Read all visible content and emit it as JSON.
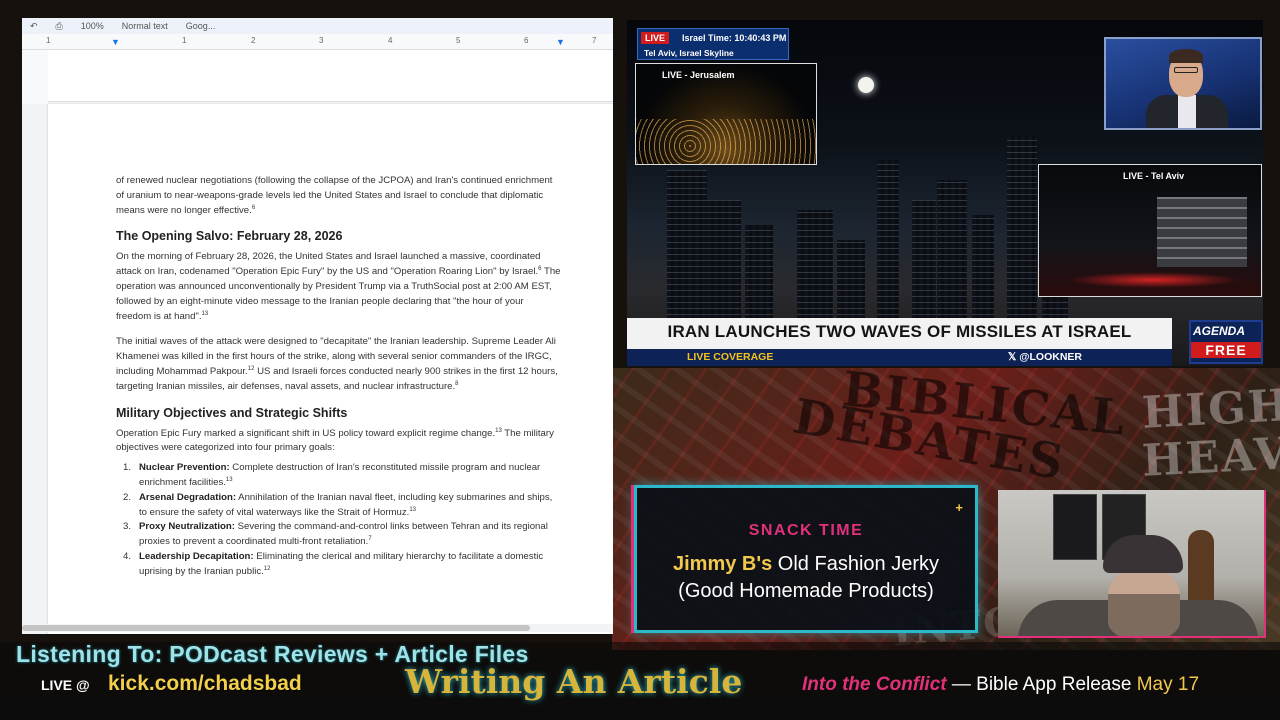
{
  "doc": {
    "toolbar": {
      "zoom": "100%",
      "style": "Normal text",
      "font": "Goog..."
    },
    "ruler": [
      "1",
      "1",
      "2",
      "3",
      "4",
      "5",
      "6",
      "7"
    ],
    "intro_paragraph": "of renewed nuclear negotiations (following the collapse of the JCPOA) and Iran's continued enrichment of uranium to near-weapons-grade levels led the United States and Israel to conclude that diplomatic means were no longer effective.",
    "intro_ref": "6",
    "heading1": "The Opening Salvo: February 28, 2026",
    "p1": "On the morning of February 28, 2026, the United States and Israel launched a massive, coordinated attack on Iran, codenamed \"Operation Epic Fury\" by the US and \"Operation Roaring Lion\" by Israel.",
    "p1_ref1": "6",
    "p1_b": " The operation was announced unconventionally by President Trump via a TruthSocial post at 2:00 AM EST, followed by an eight-minute video message to the Iranian people declaring that \"the hour of your freedom is at hand\".",
    "p1_ref2": "13",
    "p2": "The initial waves of the attack were designed to \"decapitate\" the Iranian leadership. Supreme Leader Ali Khamenei was killed in the first hours of the strike, along with several senior commanders of the IRGC, including Mohammad Pakpour.",
    "p2_ref1": "12",
    "p2_b": " US and Israeli forces conducted nearly 900 strikes in the first 12 hours, targeting Iranian missiles, air defenses, naval assets, and nuclear infrastructure.",
    "p2_ref2": "8",
    "heading2": "Military Objectives and Strategic Shifts",
    "p3": "Operation Epic Fury marked a significant shift in US policy toward explicit regime change.",
    "p3_ref": "13",
    "p3_b": " The military objectives were categorized into four primary goals:",
    "list": [
      {
        "num": "1.",
        "title": "Nuclear Prevention:",
        "text": " Complete destruction of Iran's reconstituted missile program and nuclear enrichment facilities.",
        "ref": "13"
      },
      {
        "num": "2.",
        "title": "Arsenal Degradation:",
        "text": " Annihilation of the Iranian naval fleet, including key submarines and ships, to ensure the safety of vital waterways like the Strait of Hormuz.",
        "ref": "13"
      },
      {
        "num": "3.",
        "title": "Proxy Neutralization:",
        "text": " Severing the command-and-control links between Tehran and its regional proxies to prevent a coordinated multi-front retaliation.",
        "ref": "7"
      },
      {
        "num": "4.",
        "title": "Leadership Decapitation:",
        "text": " Eliminating the clerical and military hierarchy to facilitate a domestic uprising by the Iranian public.",
        "ref": "12"
      }
    ]
  },
  "news": {
    "live_tag": "LIVE",
    "time": "Israel Time: 10:40:43 PM",
    "location": "Tel Aviv, Israel Skyline",
    "inset_jerusalem": "LIVE - Jerusalem",
    "inset_telaviv": "LIVE - Tel Aviv",
    "headline": "IRAN LAUNCHES TWO WAVES OF MISSILES AT ISRAEL",
    "coverage": "LIVE COVERAGE",
    "handle": "𝕏 @LOOKNER",
    "brand_top": "AGENDA",
    "brand_bottom": "FREE"
  },
  "background_words": [
    "BIBLICAL",
    "DEBATES",
    "HIGHER",
    "HEAVEN",
    "INTO THE"
  ],
  "snack": {
    "title": "SNACK TIME",
    "highlight": "Jimmy B's",
    "line1_rest": " Old Fashion Jerky",
    "line2": "(Good Homemade Products)",
    "plus": "+"
  },
  "bottom": {
    "listening": "Listening To: PODcast Reviews + Article Files",
    "live_at": "LIVE @",
    "url": "kick.com/chadsbad",
    "writing": "Writing An Article",
    "conflict_part1": "Into the Conflict",
    "conflict_part2": " — Bible App Release ",
    "conflict_part3": "May 17"
  },
  "colors": {
    "accent_cyan": "#2cb8c9",
    "accent_pink": "#e0317a",
    "accent_gold": "#f2c94c",
    "news_navy": "#0d2358",
    "live_red": "#d01c1c"
  }
}
